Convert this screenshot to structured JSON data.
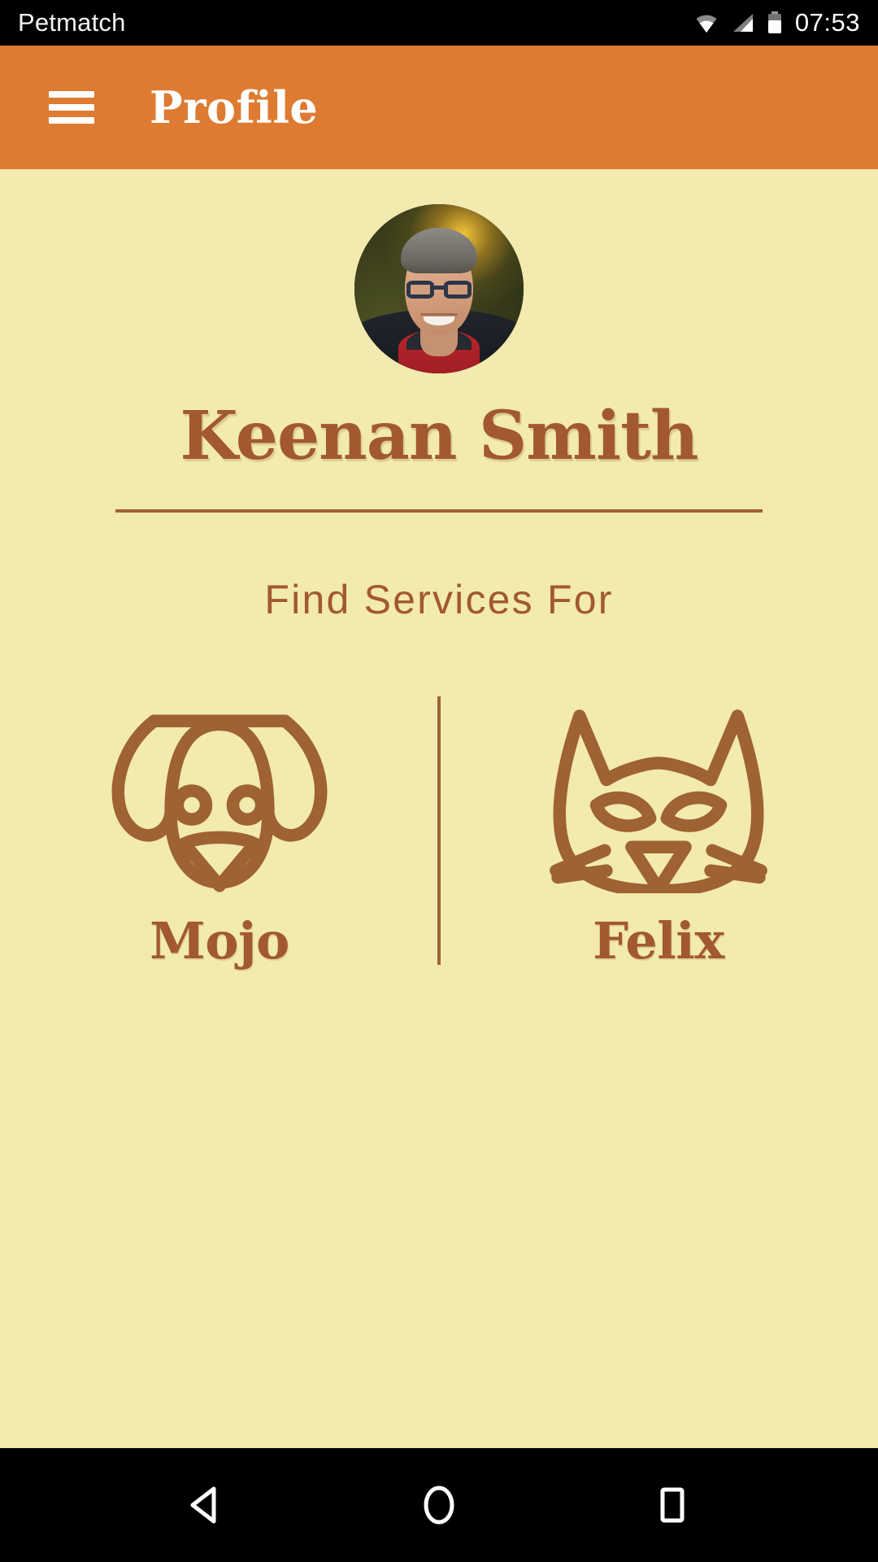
{
  "status_bar": {
    "app_name": "Petmatch",
    "clock": "07:53",
    "icons": [
      "wifi-icon",
      "cell-signal-icon",
      "battery-icon"
    ]
  },
  "app_bar": {
    "menu_icon": "hamburger-menu-icon",
    "title": "Profile",
    "background_color": "#DE7B32",
    "text_color": "#FFFFFF"
  },
  "profile": {
    "avatar_alt": "user-avatar-photo",
    "name": "Keenan Smith",
    "name_color": "#A2592F"
  },
  "section": {
    "title": "Find Services For"
  },
  "pets": [
    {
      "name": "Mojo",
      "icon": "dog-face-icon",
      "species": "dog"
    },
    {
      "name": "Felix",
      "icon": "cat-face-icon",
      "species": "cat"
    }
  ],
  "theme": {
    "background": "#F2EAAE",
    "accent_orange": "#DE7B32",
    "accent_brown": "#A2592F",
    "divider": "#9E6233"
  },
  "nav_bar": {
    "back": "back-triangle-icon",
    "home": "home-circle-icon",
    "recents": "recents-square-icon"
  }
}
